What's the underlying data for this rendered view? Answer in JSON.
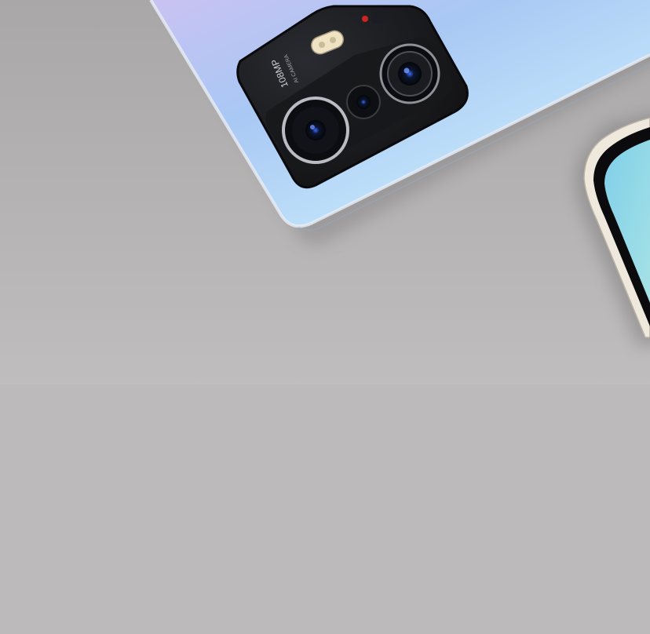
{
  "scene": {
    "subject": "smartphones",
    "background_color": "#bdbbbb",
    "phone_back_colors": [
      "#c9c2f2",
      "#a9c8f4",
      "#c4e6fa"
    ],
    "camera_module_color": "#151517",
    "flash_color": "#efe3c3",
    "second_phone_screen_color": "#8fd6e8"
  },
  "camera_module_text": {
    "megapixels": "108MP",
    "subtitle": "AI CAMERA"
  }
}
